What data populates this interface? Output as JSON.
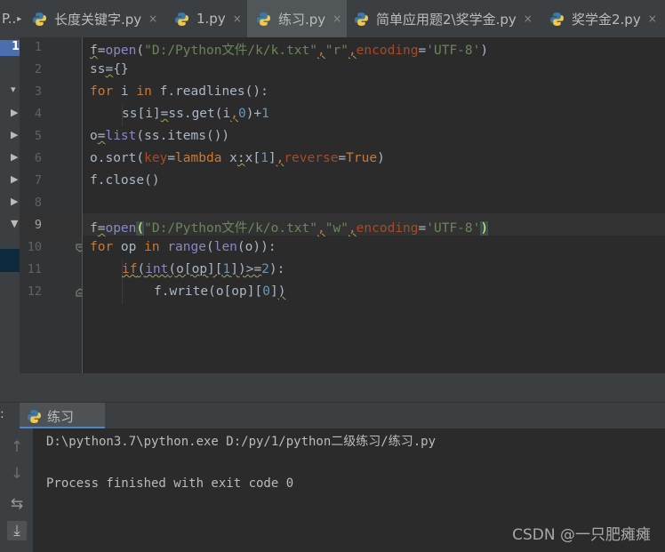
{
  "tabs": [
    {
      "label": "P..",
      "active": false
    },
    {
      "label": "长度关键字.py",
      "active": false
    },
    {
      "label": "1.py",
      "active": false
    },
    {
      "label": "练习.py",
      "active": true
    },
    {
      "label": "简单应用题2\\奖学金.py",
      "active": false
    },
    {
      "label": "奖学金2.py",
      "active": false
    }
  ],
  "tab_close_glyph": "×",
  "tab_overflow_glyph": "▸",
  "left_strip_label": "1",
  "line_numbers": [
    "1",
    "2",
    "3",
    "4",
    "5",
    "6",
    "7",
    "8",
    "9",
    "10",
    "11",
    "12"
  ],
  "current_line": "9",
  "code": {
    "l1": {
      "a": "f",
      "b": "=",
      "c": "open",
      "d": "(",
      "e": "\"D:/Python文件/k/k.txt\"",
      "f": ",",
      "g": "\"r\"",
      "h": ",",
      "i": "encoding",
      "j": "=",
      "k": "'UTF-8'",
      "l": ")"
    },
    "l2": {
      "a": "ss",
      "b": "=",
      "c": "{}"
    },
    "l3": {
      "a": "for",
      "b": " i ",
      "c": "in",
      "d": " f.readlines():"
    },
    "l4": {
      "a": "ss[i]",
      "b": "=",
      "c": "ss.get(i",
      "d": ",",
      "e": "0",
      "f": ")+",
      "g": "1"
    },
    "l5": {
      "a": "o",
      "b": "=",
      "c": "list",
      "d": "(ss.items())"
    },
    "l6": {
      "a": "o.sort(",
      "b": "key",
      "c": "=",
      "d": "lambda",
      "e": " x",
      "f": ":",
      "g": "x[",
      "h": "1",
      "i": "]",
      "j": ",",
      "k": "reverse",
      "l": "=",
      "m": "True",
      "n": ")"
    },
    "l7": {
      "a": "f.close()"
    },
    "l9": {
      "a": "f",
      "b": "=",
      "c": "open",
      "d": "(",
      "e": "\"D:/Python文件/k/o.txt\"",
      "f": ",",
      "g": "\"w\"",
      "h": ",",
      "i": "encoding",
      "j": "=",
      "k": "'UTF-8'",
      "l": ")"
    },
    "l10": {
      "a": "for",
      "b": " op ",
      "c": "in",
      "d": " ",
      "e": "range",
      "f": "(",
      "g": "len",
      "h": "(o)):"
    },
    "l11": {
      "a": "if",
      "b": "(",
      "c": "int",
      "d": "(o[op][",
      "e": "1",
      "f": "])>=",
      "g": "2",
      "h": "):"
    },
    "l12": {
      "a": "f.write(o[op][",
      "b": "0",
      "c": "]",
      "d": ")"
    }
  },
  "run_panel": {
    "side_label": ":",
    "tab_label": "练习",
    "tools": [
      "up-arrow",
      "down-arrow",
      "soft-wrap",
      "scroll-to-end"
    ],
    "console_lines": [
      "D:\\python3.7\\python.exe D:/py/1/python二级练习/练习.py",
      "",
      "Process finished with exit code 0"
    ]
  },
  "watermark": "CSDN @一只肥瘫瘫",
  "colors": {
    "keyword": "#cc7832",
    "string": "#6a8759",
    "number": "#6897bb",
    "builtin": "#8888c6",
    "kwarg": "#aa4926",
    "default_text": "#a9b7c6",
    "background": "#2b2b2b"
  }
}
